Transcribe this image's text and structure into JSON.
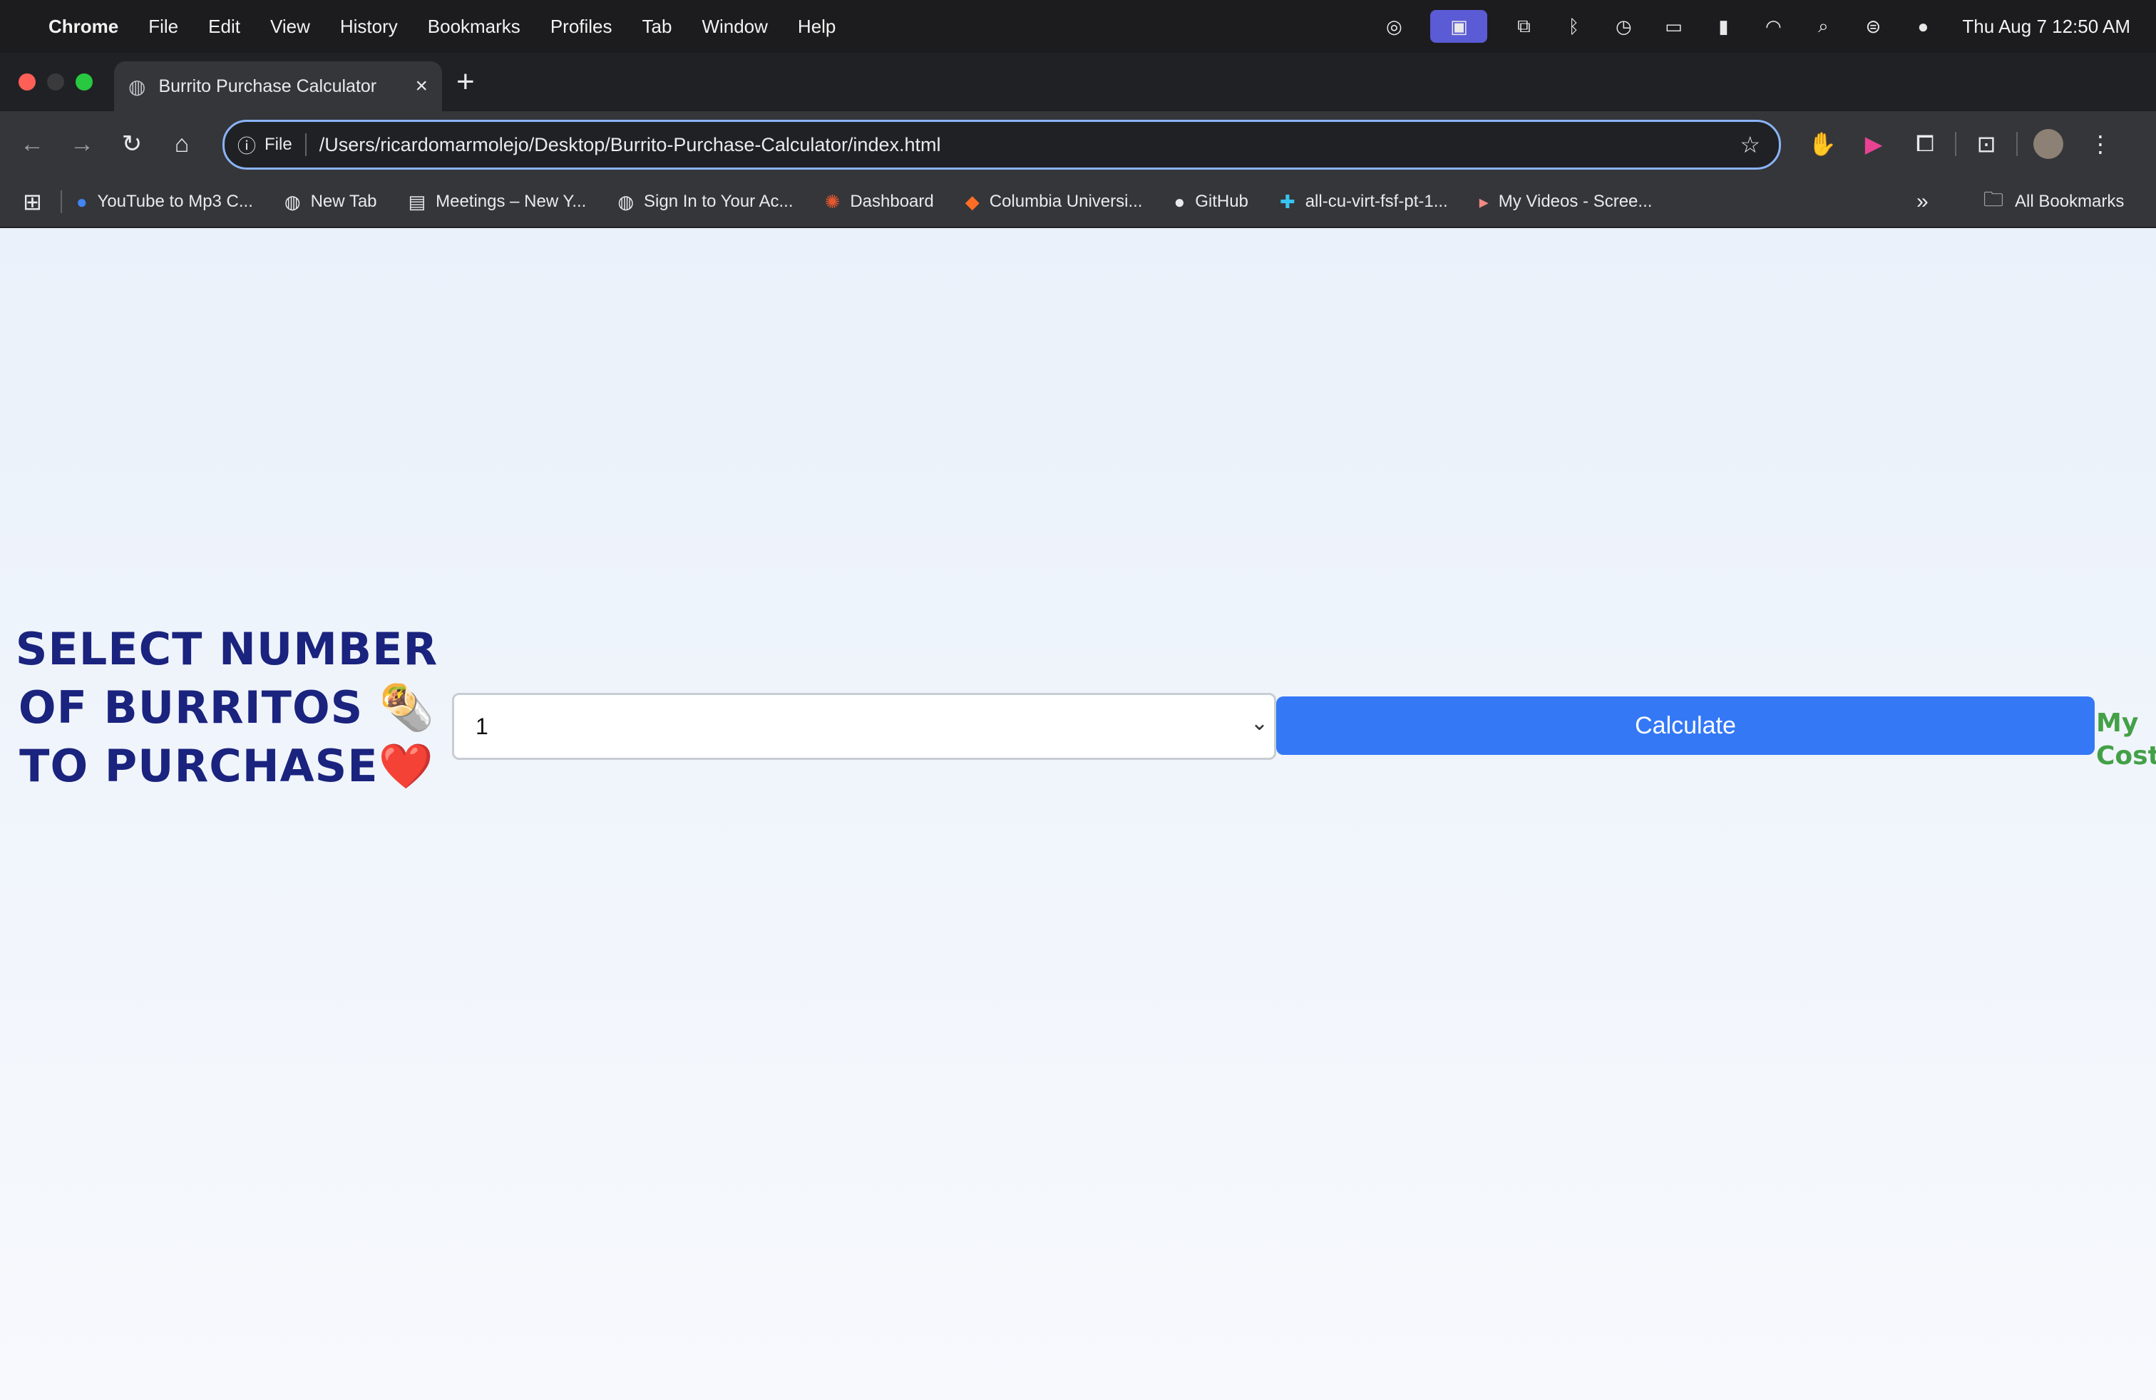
{
  "menubar": {
    "app": "Chrome",
    "items": [
      "File",
      "Edit",
      "View",
      "History",
      "Bookmarks",
      "Profiles",
      "Tab",
      "Window",
      "Help"
    ],
    "clock": "Thu Aug 7  12:50 AM"
  },
  "browser": {
    "tab_title": "Burrito Purchase Calculator",
    "omnibox_scheme": "File",
    "url": "/Users/ricardomarmolejo/Desktop/Burrito-Purchase-Calculator/index.html"
  },
  "bookmarks": {
    "items": [
      {
        "label": "YouTube to Mp3 C...",
        "icon": "chevron-badge-icon"
      },
      {
        "label": "New Tab",
        "icon": "globe-icon"
      },
      {
        "label": "Meetings – New Y...",
        "icon": "page-icon"
      },
      {
        "label": "Sign In to Your Ac...",
        "icon": "globe-icon"
      },
      {
        "label": "Dashboard",
        "icon": "canvas-icon"
      },
      {
        "label": "Columbia Universi...",
        "icon": "gitlab-icon"
      },
      {
        "label": "GitHub",
        "icon": "github-icon"
      },
      {
        "label": "all-cu-virt-fsf-pt-1...",
        "icon": "slack-icon"
      },
      {
        "label": "My Videos - Scree...",
        "icon": "video-icon"
      }
    ],
    "all_label": "All Bookmarks"
  },
  "page": {
    "heading_line1": "SELECT NUMBER",
    "heading_line2": "OF BURRITOS 🌯",
    "heading_line3": "TO PURCHASE❤️",
    "select_value": "1",
    "calculate_label": "Calculate",
    "cost_label": "My Cost"
  },
  "colors": {
    "heading": "#1a237e",
    "button": "#3478f6",
    "cost": "#43a047"
  }
}
